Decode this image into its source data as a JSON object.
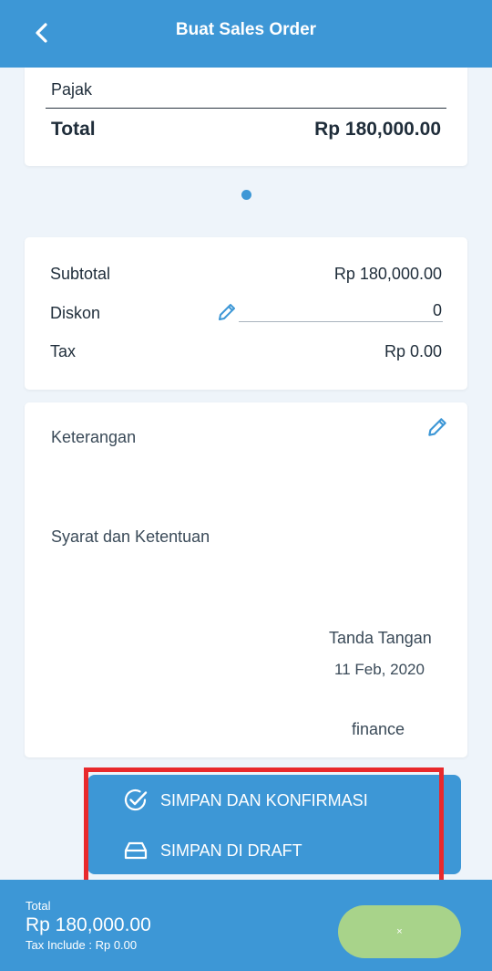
{
  "header": {
    "title": "Buat Sales Order",
    "back_icon": "chevron-left-icon"
  },
  "top_card": {
    "pajak_label": "Pajak",
    "total_label": "Total",
    "total_value": "Rp 180,000.00"
  },
  "summary": {
    "subtotal_label": "Subtotal",
    "subtotal_value": "Rp 180,000.00",
    "discount_label": "Diskon",
    "discount_value": "0",
    "tax_label": "Tax",
    "tax_value": "Rp 0.00"
  },
  "notes": {
    "keterangan_label": "Keterangan",
    "syarat_label": "Syarat dan Ketentuan",
    "signature_label": "Tanda Tangan",
    "signature_date": "11 Feb, 2020",
    "signature_name": "finance"
  },
  "fab_menu": {
    "confirm_label": "SIMPAN DAN KONFIRMASI",
    "draft_label": "SIMPAN DI DRAFT"
  },
  "bottom_bar": {
    "total_label": "Total",
    "total_value": "Rp 180,000.00",
    "tax_include": "Tax Include : Rp 0.00",
    "close_label": "×"
  },
  "colors": {
    "primary": "#3d97d6",
    "highlight": "#e8292c",
    "close_button": "#a8d38a"
  }
}
